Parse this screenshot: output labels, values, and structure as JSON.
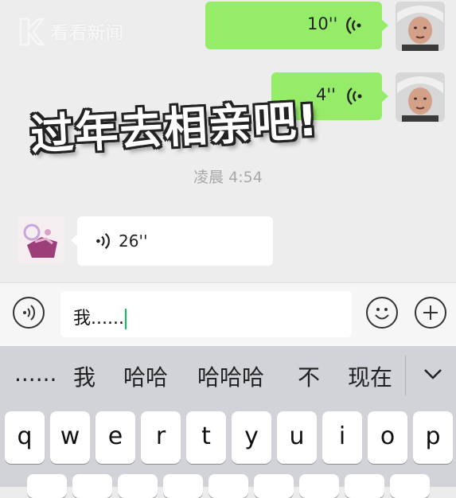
{
  "watermark": {
    "text": "看看新闻"
  },
  "messages": {
    "outgoing": [
      {
        "duration": "10''"
      },
      {
        "duration": "4''"
      }
    ],
    "timestamp": "凌晨 4:54",
    "incoming": {
      "duration": "26''"
    }
  },
  "caption": "过年去相亲吧!",
  "input": {
    "value": "我......"
  },
  "keyboard": {
    "candidates": [
      "......",
      "我",
      "哈哈",
      "哈哈哈",
      "不",
      "现在"
    ],
    "keys": [
      "q",
      "w",
      "e",
      "r",
      "t",
      "y",
      "u",
      "i",
      "o",
      "p"
    ]
  },
  "colors": {
    "outgoing_bubble": "#95ec69",
    "caret": "#07c160"
  }
}
